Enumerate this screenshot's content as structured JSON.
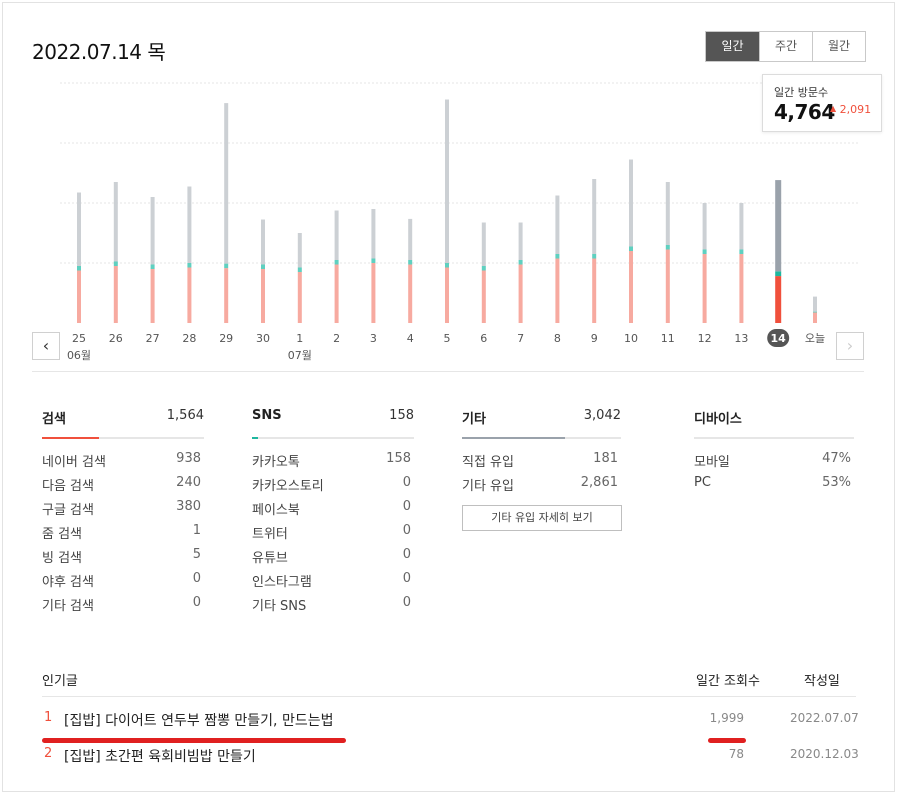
{
  "header": {
    "date_title": "2022.07.14 목",
    "tabs": [
      {
        "label": "일간",
        "active": true
      },
      {
        "label": "주간",
        "active": false
      },
      {
        "label": "월간",
        "active": false
      }
    ]
  },
  "tooltip": {
    "label": "일간 방문수",
    "value": "4,764",
    "delta": "2,091"
  },
  "colors": {
    "accent": "#f0503c",
    "bar_other": "#ccd0d4",
    "bar_sns": "#5fd0c0",
    "bar_search": "#f7aaa0",
    "selected_other": "#9aa2ab",
    "selected_search": "#f0503c",
    "selected_sns": "#1fb79f"
  },
  "chart_data": {
    "type": "bar",
    "stacked": true,
    "categories": [
      "25",
      "26",
      "27",
      "28",
      "29",
      "30",
      "1",
      "2",
      "3",
      "4",
      "5",
      "6",
      "7",
      "8",
      "9",
      "10",
      "11",
      "12",
      "13",
      "14",
      "오늘"
    ],
    "month_labels": [
      {
        "index": 0,
        "label": "06월"
      },
      {
        "index": 6,
        "label": "07월"
      }
    ],
    "selected_index": 19,
    "series": [
      {
        "values": [
          1750,
          1900,
          1800,
          1850,
          1830,
          1800,
          1700,
          1950,
          2000,
          1950,
          1850,
          1750,
          1950,
          2150,
          2150,
          2400,
          2450,
          2300,
          2300,
          1564,
          350
        ]
      },
      {
        "values": [
          150,
          150,
          150,
          150,
          150,
          150,
          150,
          150,
          150,
          150,
          150,
          150,
          150,
          150,
          150,
          150,
          150,
          150,
          150,
          158,
          30
        ]
      },
      {
        "values": [
          2450,
          2650,
          2250,
          2550,
          5350,
          1500,
          1150,
          1650,
          1650,
          1370,
          5450,
          1450,
          1250,
          1950,
          2500,
          2900,
          2100,
          1550,
          1550,
          3042,
          500
        ]
      }
    ],
    "ylim": [
      0,
      8000
    ],
    "grid": true
  },
  "nav": {
    "prev": "‹",
    "next": "›"
  },
  "stats": {
    "search": {
      "title": "검색",
      "total": "1,564",
      "fill": 0.35,
      "rows": [
        {
          "label": "네이버 검색",
          "value": "938"
        },
        {
          "label": "다음 검색",
          "value": "240"
        },
        {
          "label": "구글 검색",
          "value": "380"
        },
        {
          "label": "줌 검색",
          "value": "1"
        },
        {
          "label": "빙 검색",
          "value": "5"
        },
        {
          "label": "야후 검색",
          "value": "0"
        },
        {
          "label": "기타 검색",
          "value": "0"
        }
      ]
    },
    "sns": {
      "title": "SNS",
      "total": "158",
      "fill": 0.04,
      "rows": [
        {
          "label": "카카오톡",
          "value": "158"
        },
        {
          "label": "카카오스토리",
          "value": "0"
        },
        {
          "label": "페이스북",
          "value": "0"
        },
        {
          "label": "트위터",
          "value": "0"
        },
        {
          "label": "유튜브",
          "value": "0"
        },
        {
          "label": "인스타그램",
          "value": "0"
        },
        {
          "label": "기타 SNS",
          "value": "0"
        }
      ]
    },
    "other": {
      "title": "기타",
      "total": "3,042",
      "fill": 0.65,
      "rows": [
        {
          "label": "직접 유입",
          "value": "181"
        },
        {
          "label": "기타 유입",
          "value": "2,861"
        }
      ],
      "detail_button": "기타 유입 자세히 보기"
    },
    "device": {
      "title": "디바이스",
      "rows": [
        {
          "label": "모바일",
          "value": "47%"
        },
        {
          "label": "PC",
          "value": "53%"
        }
      ]
    }
  },
  "popular": {
    "header": {
      "title": "인기글",
      "views": "일간 조회수",
      "date": "작성일"
    },
    "posts": [
      {
        "rank": "1",
        "title": "[집밥] 다이어트 연두부 짬뽕 만들기, 만드는법",
        "views": "1,999",
        "date": "2022.07.07"
      },
      {
        "rank": "2",
        "title": "[집밥] 초간편 육회비빔밥 만들기",
        "views": "78",
        "date": "2020.12.03"
      }
    ]
  }
}
